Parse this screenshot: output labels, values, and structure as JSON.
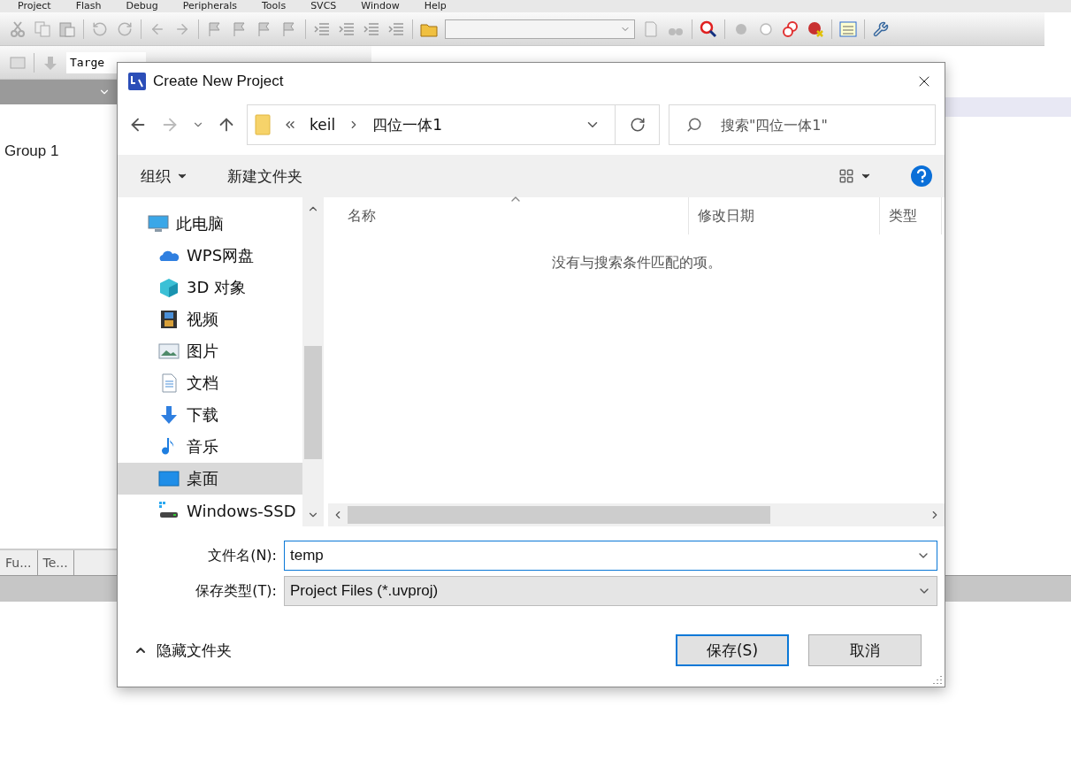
{
  "ide": {
    "menu": [
      "Project",
      "Flash",
      "Debug",
      "Peripherals",
      "Tools",
      "SVCS",
      "Window",
      "Help"
    ],
    "target_field": "Targe",
    "tree": [
      {
        "label": "Group 1"
      }
    ],
    "panel_tabs": [
      {
        "label": "Fu...",
        "selected": false
      },
      {
        "label": "Te...",
        "selected": false
      }
    ]
  },
  "dialog": {
    "title": "Create New Project",
    "path": [
      "keil",
      "四位一体1"
    ],
    "search": {
      "placeholder": "搜索\"四位一体1\""
    },
    "toolbar": {
      "organize": "组织",
      "new_folder": "新建文件夹"
    },
    "nav_items": [
      {
        "label": "此电脑",
        "kind": "pc",
        "selected": false
      },
      {
        "label": "WPS网盘",
        "kind": "cloud",
        "selected": false
      },
      {
        "label": "3D 对象",
        "kind": "cube",
        "selected": false
      },
      {
        "label": "视频",
        "kind": "video",
        "selected": false
      },
      {
        "label": "图片",
        "kind": "picture",
        "selected": false
      },
      {
        "label": "文档",
        "kind": "document",
        "selected": false
      },
      {
        "label": "下载",
        "kind": "download",
        "selected": false
      },
      {
        "label": "音乐",
        "kind": "music",
        "selected": false
      },
      {
        "label": "桌面",
        "kind": "desktop",
        "selected": true
      },
      {
        "label": "Windows-SSD",
        "kind": "drive",
        "selected": false
      }
    ],
    "columns": [
      "名称",
      "修改日期",
      "类型"
    ],
    "empty_message": "没有与搜索条件匹配的项。",
    "filename": {
      "label": "文件名(N):",
      "value": "temp"
    },
    "filetype": {
      "label": "保存类型(T):",
      "value": "Project Files (*.uvproj)"
    },
    "hide_folders": "隐藏文件夹",
    "buttons": [
      {
        "label": "保存(S)",
        "kind": "primary"
      },
      {
        "label": "取消",
        "kind": "normal"
      }
    ]
  }
}
